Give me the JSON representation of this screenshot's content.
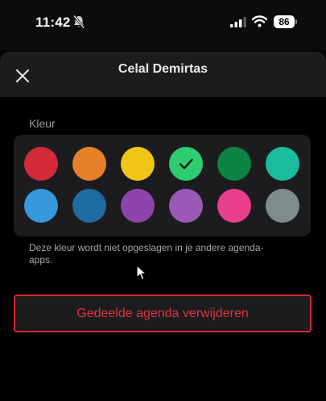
{
  "status_bar": {
    "time": "11:42",
    "battery": "86",
    "icons": [
      "bell-slash-icon",
      "cellular-signal-icon",
      "wifi-icon",
      "battery-icon"
    ]
  },
  "sheet": {
    "title": "Celal Demirtas",
    "close_icon": "close-icon"
  },
  "color_section": {
    "label": "Kleur",
    "selected": "green",
    "swatches": [
      {
        "name": "red",
        "color": "#d32a3a"
      },
      {
        "name": "orange",
        "color": "#e6812a"
      },
      {
        "name": "yellow",
        "color": "#f0c518"
      },
      {
        "name": "green",
        "color": "#2ecc71"
      },
      {
        "name": "dark-green",
        "color": "#0a8440"
      },
      {
        "name": "teal",
        "color": "#1abc9c"
      },
      {
        "name": "light-blue",
        "color": "#3498db"
      },
      {
        "name": "dark-blue",
        "color": "#1f6aa3"
      },
      {
        "name": "purple",
        "color": "#8e44ad"
      },
      {
        "name": "lavender",
        "color": "#9b59b6"
      },
      {
        "name": "pink",
        "color": "#e83e8c"
      },
      {
        "name": "gray",
        "color": "#7f8c8d"
      }
    ],
    "hint": "Deze kleur wordt niet opgeslagen in je andere agenda-apps."
  },
  "actions": {
    "delete_label": "Gedeelde agenda verwijderen",
    "danger_color": "#e0343c"
  }
}
